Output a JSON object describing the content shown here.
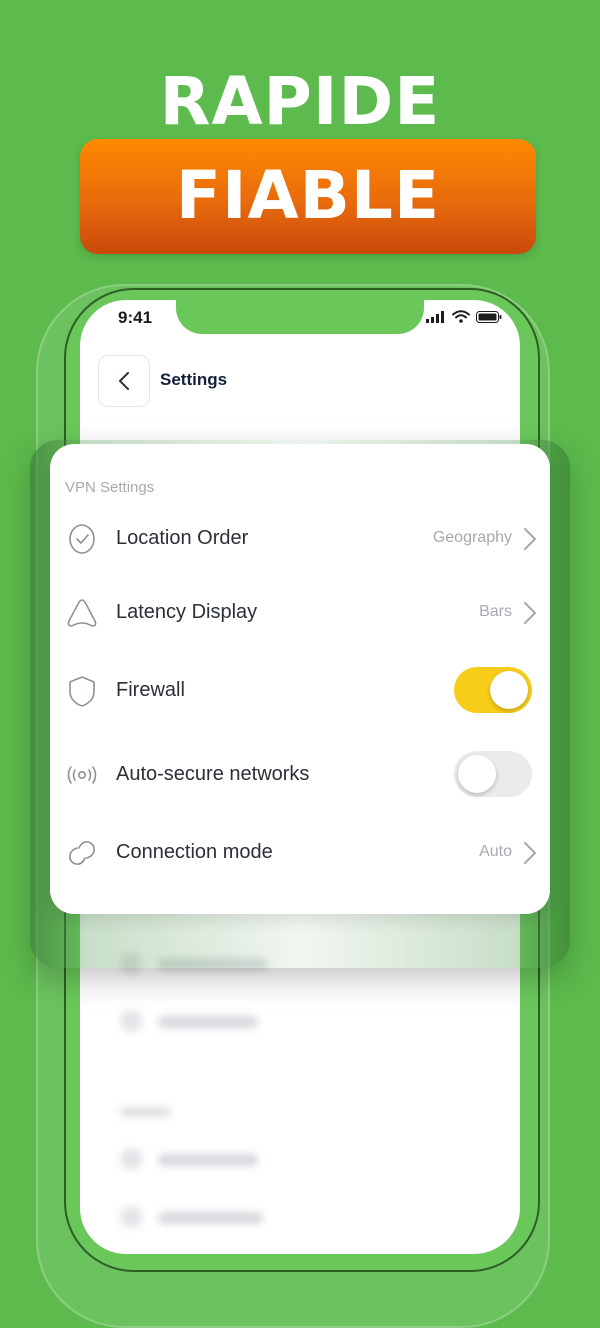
{
  "headline": {
    "top": "RAPIDE",
    "bottom": "FIABLE"
  },
  "status_bar": {
    "time": "9:41"
  },
  "header": {
    "title": "Settings"
  },
  "section": {
    "label": "VPN Settings",
    "items": [
      {
        "label": "Location Order",
        "value": "Geography",
        "icon": "shield-check-icon",
        "control": "chevron"
      },
      {
        "label": "Latency Display",
        "value": "Bars",
        "icon": "signal-triangle-icon",
        "control": "chevron"
      },
      {
        "label": "Firewall",
        "icon": "shield-icon",
        "control": "toggle",
        "toggle_on": true
      },
      {
        "label": "Auto-secure networks",
        "icon": "broadcast-icon",
        "control": "toggle",
        "toggle_on": false
      },
      {
        "label": "Connection mode",
        "value": "Auto",
        "icon": "link-icon",
        "control": "chevron"
      }
    ]
  },
  "colors": {
    "background": "#5cbb4c",
    "banner_orange": "#e86a0c",
    "toggle_on": "#f7cd1a",
    "toggle_off": "#eaebed",
    "text_primary": "#2b2f38",
    "text_secondary": "#a5a9b0"
  }
}
